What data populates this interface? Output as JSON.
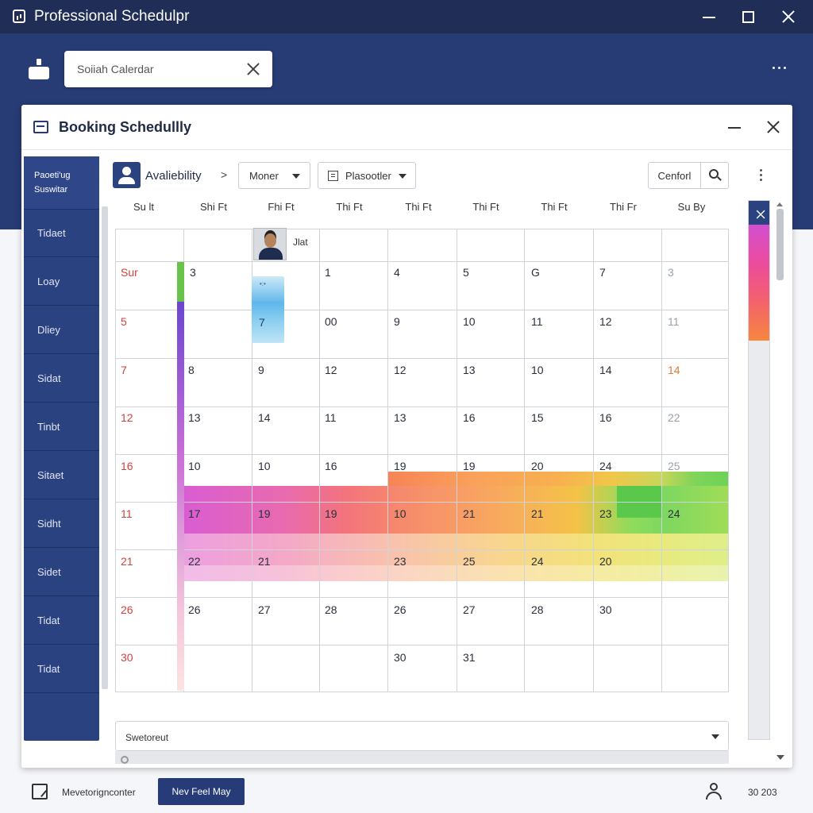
{
  "window": {
    "title": "Professional Schedulpr"
  },
  "header": {
    "search_value": "Soiiah Calerdar"
  },
  "panel": {
    "title": "Booking Schedullly"
  },
  "sidebar": {
    "items": [
      {
        "label": "Paoeti'ug Suswitar"
      },
      {
        "label": "Tidaet"
      },
      {
        "label": "Loay"
      },
      {
        "label": "Dliey"
      },
      {
        "label": "Sidat"
      },
      {
        "label": "Tinbt"
      },
      {
        "label": "Sitaet"
      },
      {
        "label": "Sidht"
      },
      {
        "label": "Sidet"
      },
      {
        "label": "Tidat"
      },
      {
        "label": "Tidat"
      }
    ]
  },
  "toolbar": {
    "availability_label": "Avaliebility",
    "view_dropdown": "Moner",
    "filter_dropdown": "Plasootler",
    "confirm_button": "Cenforl"
  },
  "calendar": {
    "day_headers": [
      "Su lt",
      "Shi Ft",
      "Fhi Ft",
      "Thi Ft",
      "Thi Ft",
      "Thi Ft",
      "Thi Ft",
      "Thi Fr",
      "Su By"
    ],
    "photo_label": "Jlat",
    "event_tiny_label": "•:•",
    "event_number": "7",
    "rows": [
      [
        "Sur",
        "3",
        "",
        "1",
        "4",
        "5",
        "G",
        "7",
        "3"
      ],
      [
        "5",
        "",
        "",
        "00",
        "9",
        "10",
        "11",
        "12",
        "11"
      ],
      [
        "7",
        "8",
        "9",
        "12",
        "12",
        "13",
        "10",
        "14",
        "14"
      ],
      [
        "12",
        "13",
        "14",
        "11",
        "13",
        "16",
        "15",
        "16",
        "22"
      ],
      [
        "16",
        "10",
        "10",
        "16",
        "19",
        "19",
        "20",
        "24",
        "25"
      ],
      [
        "11",
        "17",
        "19",
        "19",
        "10",
        "21",
        "21",
        "23",
        "24"
      ],
      [
        "21",
        "22",
        "21",
        "",
        "23",
        "25",
        "24",
        "20",
        ""
      ],
      [
        "26",
        "26",
        "27",
        "28",
        "26",
        "27",
        "28",
        "30",
        ""
      ],
      [
        "30",
        "",
        "",
        "",
        "30",
        "31",
        "",
        "",
        ""
      ]
    ]
  },
  "footer": {
    "dropdown_label": "Swetoreut",
    "status_text": "Mevetorignconter",
    "primary_button": "Nev Feel May",
    "count_text": "30 203"
  },
  "colors": {
    "title_bar": "#1f2d57",
    "header_band": "#273b74",
    "sidebar": "#2b4280",
    "weekend_red": "#d0423c"
  }
}
